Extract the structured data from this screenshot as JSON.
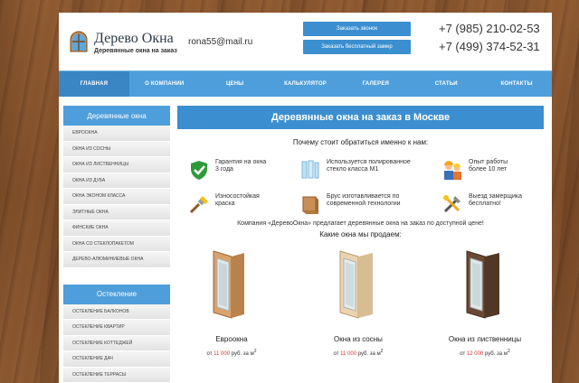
{
  "header": {
    "logo_title": "Дерево Окна",
    "logo_sub": "Деревянные окна на заказ",
    "email": "rona55@mail.ru",
    "cta_call": "Заказать звонок",
    "cta_measure": "Заказать бесплатный замер",
    "phone1": "+7 (985) 210-02-53",
    "phone2": "+7 (499) 374-52-31"
  },
  "nav": [
    "ГЛАВНАЯ",
    "О КОМПАНИИ",
    "ЦЕНЫ",
    "КАЛЬКУЛЯТОР",
    "ГАЛЕРЕЯ",
    "СТАТЬИ",
    "КОНТАКТЫ"
  ],
  "sidebar": {
    "section1_title": "Деревянные окна",
    "section1_items": [
      "ЕВРООКНА",
      "ОКНА ИЗ СОСНЫ",
      "ОКНА ИЗ ЛИСТВЕННИЦЫ",
      "ОКНА ИЗ ДУБА",
      "ОКНА ЭКОНОМ КЛАССА",
      "ЭЛИТНЫЕ ОКНА",
      "ФИНСКИЕ ОКНА",
      "ОКНА СО СТЕКЛОПАКЕТОМ",
      "ДЕРЕВО-АЛЮМИНИЕВЫЕ ОКНА"
    ],
    "section2_title": "Остекление",
    "section2_items": [
      "ОСТЕКЛЕНИЕ БАЛКОНОВ",
      "ОСТЕКЛЕНИЕ КВАРТИР",
      "ОСТЕКЛЕНИЕ КОТТЕДЖЕЙ",
      "ОСТЕКЛЕНИЕ ДАЧ",
      "ОСТЕКЛЕНИЕ ТЕРРАСЫ"
    ]
  },
  "main": {
    "banner": "Деревянные окна на заказ в Москве",
    "why_title": "Почему стоит обратиться именно к нам:",
    "features": [
      {
        "icon": "shield-check-icon",
        "line1": "Гарантия на окна",
        "line2": "3 года"
      },
      {
        "icon": "glass-icon",
        "line1": "Используется полированное",
        "line2": "стекло класса М1"
      },
      {
        "icon": "workers-icon",
        "line1": "Опыт работы",
        "line2": "более 10 лет"
      },
      {
        "icon": "brush-icon",
        "line1": "Износостойкая",
        "line2": "краска"
      },
      {
        "icon": "timber-icon",
        "line1": "Брус изготавливается по",
        "line2": "современной технологии"
      },
      {
        "icon": "tools-icon",
        "line1": "Выезд замерщика",
        "line2": "бесплатно!"
      }
    ],
    "company_text": "Компания «ДеревоОкна» предлагает деревянные окна на заказ по доступной цене!",
    "which_title": "Какие окна мы продаем:",
    "products": [
      {
        "name": "Евроокна",
        "price_prefix": "от",
        "price": "11 000",
        "price_suffix": "руб. за м",
        "sup": "2"
      },
      {
        "name": "Окна из сосны",
        "price_prefix": "от",
        "price": "11 000",
        "price_suffix": "руб. за м",
        "sup": "2"
      },
      {
        "name": "Окна из лиственницы",
        "price_prefix": "от",
        "price": "12 000",
        "price_suffix": "руб. за м",
        "sup": "2"
      }
    ]
  },
  "colors": {
    "accent": "#3b8fd0",
    "nav": "#4e9edb",
    "price": "#dd3333"
  }
}
